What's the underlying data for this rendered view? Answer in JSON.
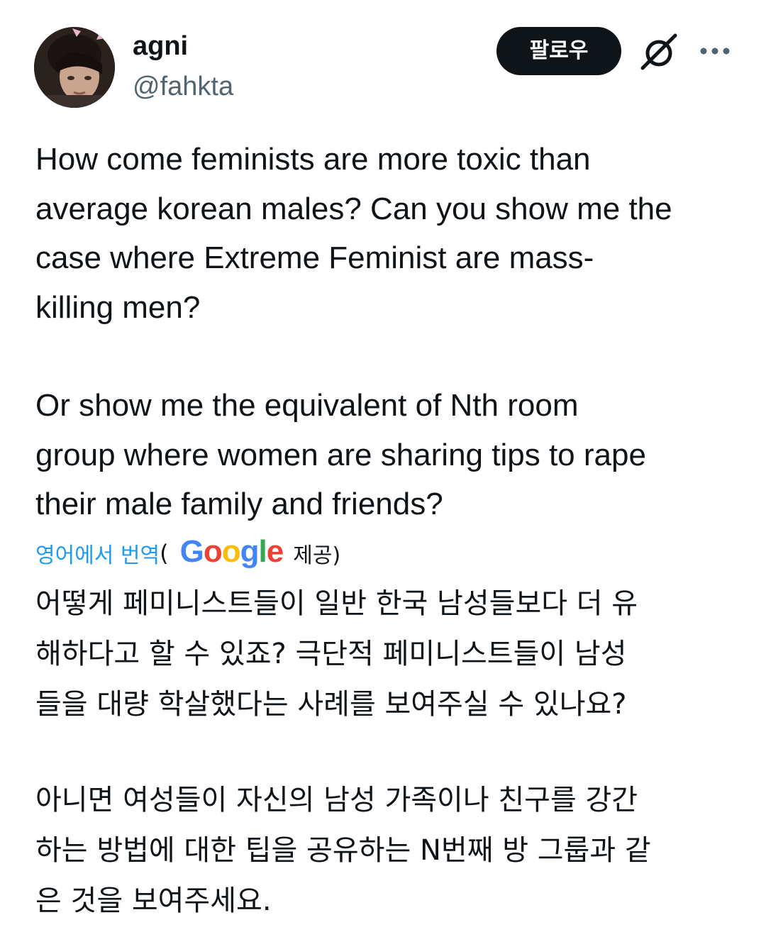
{
  "author": {
    "display_name": "agni",
    "handle": "@fahkta",
    "avatar_icon": "profile-photo"
  },
  "actions": {
    "follow_label": "팔로우",
    "grok_icon": "grok-icon",
    "more_icon": "more-dots-icon"
  },
  "tweet": {
    "paragraph1": "How come feminists are more toxic than\naverage korean males? Can you show me the\ncase where Extreme Feminist are mass-\nkilling men?",
    "paragraph2": "Or show me the equivalent of Nth room\ngroup where women are sharing tips to rape\ntheir male family and friends?"
  },
  "translation": {
    "link_label": "영어에서 번역",
    "open_paren": "(",
    "provider": "Google",
    "provided_label": "제공)",
    "paragraph1": "어떻게 페미니스트들이 일반 한국 남성들보다 더 유\n해하다고 할 수 있죠? 극단적 페미니스트들이 남성\n들을 대량 학살했다는 사례를 보여주실 수 있나요?",
    "paragraph2": "아니면 여성들이 자신의 남성 가족이나 친구를 강간\n하는 방법에 대한 팁을 공유하는 N번째 방 그룹과 같\n은 것을 보여주세요."
  },
  "colors": {
    "text": "#0f1419",
    "secondary": "#536471",
    "link": "#1d9bf0",
    "follow_bg": "#0f1419",
    "google_blue": "#4285f4",
    "google_red": "#ea4335",
    "google_yellow": "#fbbc05",
    "google_green": "#34a853"
  }
}
